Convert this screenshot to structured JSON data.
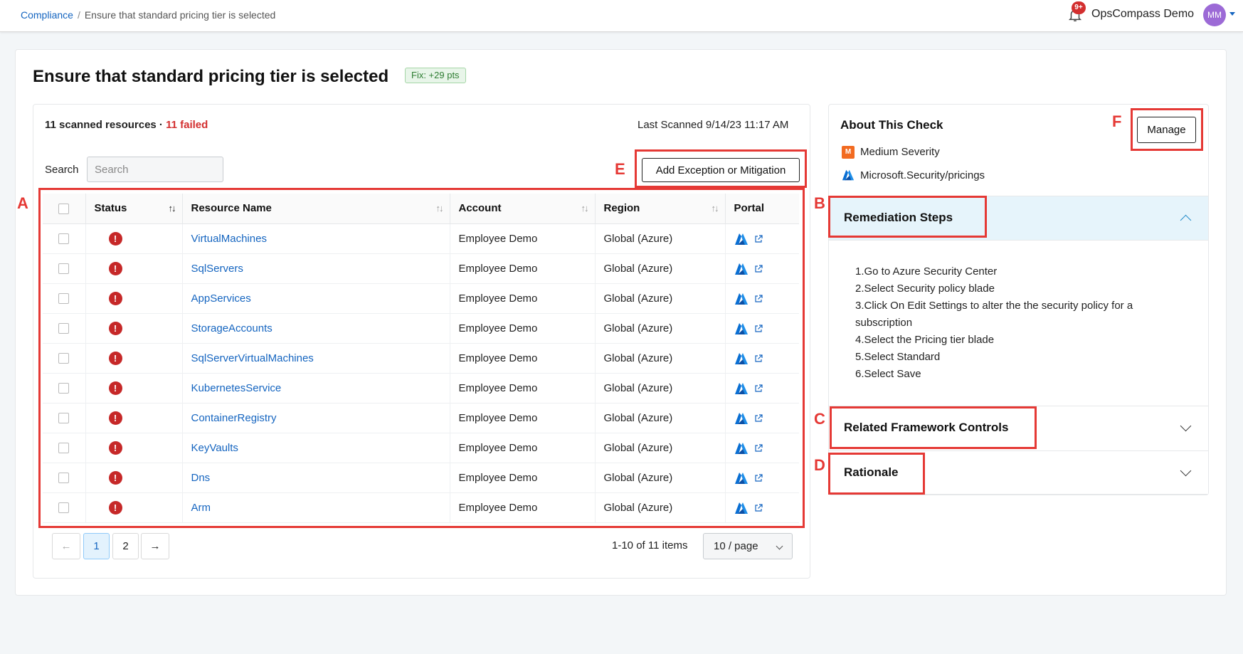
{
  "breadcrumb": {
    "root": "Compliance",
    "separator": "/",
    "current": "Ensure that standard pricing tier is selected"
  },
  "header": {
    "notification_badge": "9+",
    "org_name": "OpsCompass Demo",
    "avatar_initials": "MM"
  },
  "page": {
    "title": "Ensure that standard pricing tier is selected",
    "fix_badge": "Fix: +29 pts"
  },
  "scan": {
    "summary_prefix": "11 scanned resources · ",
    "failed_text": "11 failed",
    "last_scanned": "Last Scanned 9/14/23 11:17 AM"
  },
  "search": {
    "label": "Search",
    "placeholder": "Search"
  },
  "actions": {
    "add_exception_label": "Add Exception or Mitigation",
    "manage_label": "Manage"
  },
  "table": {
    "columns": [
      "Status",
      "Resource Name",
      "Account",
      "Region",
      "Portal"
    ],
    "rows": [
      {
        "name": "VirtualMachines",
        "account": "Employee Demo",
        "region": "Global (Azure)"
      },
      {
        "name": "SqlServers",
        "account": "Employee Demo",
        "region": "Global (Azure)"
      },
      {
        "name": "AppServices",
        "account": "Employee Demo",
        "region": "Global (Azure)"
      },
      {
        "name": "StorageAccounts",
        "account": "Employee Demo",
        "region": "Global (Azure)"
      },
      {
        "name": "SqlServerVirtualMachines",
        "account": "Employee Demo",
        "region": "Global (Azure)"
      },
      {
        "name": "KubernetesService",
        "account": "Employee Demo",
        "region": "Global (Azure)"
      },
      {
        "name": "ContainerRegistry",
        "account": "Employee Demo",
        "region": "Global (Azure)"
      },
      {
        "name": "KeyVaults",
        "account": "Employee Demo",
        "region": "Global (Azure)"
      },
      {
        "name": "Dns",
        "account": "Employee Demo",
        "region": "Global (Azure)"
      },
      {
        "name": "Arm",
        "account": "Employee Demo",
        "region": "Global (Azure)"
      }
    ]
  },
  "pagination": {
    "prev": "←",
    "pages": [
      "1",
      "2"
    ],
    "next": "→",
    "info": "1-10 of 11 items",
    "page_size": "10 / page"
  },
  "about": {
    "title": "About This Check",
    "severity_badge": "M",
    "severity": "Medium Severity",
    "provider": "Microsoft.Security/pricings"
  },
  "accordion": {
    "remediation_title": "Remediation Steps",
    "steps": [
      "1.Go to Azure Security Center",
      "2.Select Security policy blade",
      "3.Click On Edit Settings to alter the the security policy for a subscription",
      "4.Select the Pricing tier blade",
      "5.Select Standard",
      "6.Select Save"
    ],
    "framework_title": "Related Framework Controls",
    "rationale_title": "Rationale"
  },
  "annotations": {
    "A": "A",
    "B": "B",
    "C": "C",
    "D": "D",
    "E": "E",
    "F": "F"
  },
  "colors": {
    "link": "#1565c0",
    "failed": "#d32f2f",
    "annotation": "#e53935",
    "severity_medium": "#f26b21"
  }
}
